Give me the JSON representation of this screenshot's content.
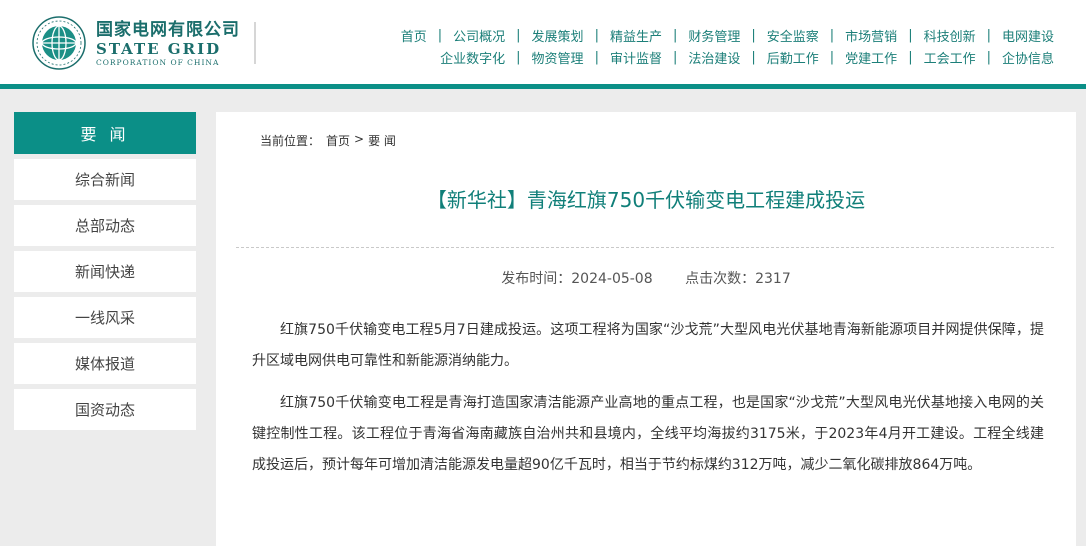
{
  "header": {
    "logo_cn": "国家电网有限公司",
    "logo_en": "STATE GRID",
    "logo_en_sub": "CORPORATION OF CHINA",
    "nav_row1": [
      "首页",
      "公司概况",
      "发展策划",
      "精益生产",
      "财务管理",
      "安全监察",
      "市场营销",
      "科技创新",
      "电网建设"
    ],
    "nav_row2": [
      "企业数字化",
      "物资管理",
      "审计监督",
      "法治建设",
      "后勤工作",
      "党建工作",
      "工会工作",
      "企协信息"
    ]
  },
  "sidebar": {
    "heading": "要 闻",
    "items": [
      "综合新闻",
      "总部动态",
      "新闻快递",
      "一线风采",
      "媒体报道",
      "国资动态"
    ]
  },
  "breadcrumb": {
    "prefix": "当前位置：",
    "home": "首页",
    "separator": ">",
    "current": "要 闻"
  },
  "article": {
    "title": "【新华社】青海红旗750千伏输变电工程建成投运",
    "publish_time": "发布时间：2024-05-08",
    "clicks": "点击次数：2317",
    "paragraphs": [
      "红旗750千伏输变电工程5月7日建成投运。这项工程将为国家“沙戈荒”大型风电光伏基地青海新能源项目并网提供保障，提升区域电网供电可靠性和新能源消纳能力。",
      "红旗750千伏输变电工程是青海打造国家清洁能源产业高地的重点工程，也是国家“沙戈荒”大型风电光伏基地接入电网的关键控制性工程。该工程位于青海省海南藏族自治州共和县境内，全线平均海拔约3175米，于2023年4月开工建设。工程全线建成投运后，预计每年可增加清洁能源发电量超90亿千瓦时，相当于节约标煤约312万吨，减少二氧化碳排放864万吨。"
    ]
  },
  "colors": {
    "brand": "#0b8f87",
    "title": "#107f79",
    "nav": "#1c7f79"
  },
  "icons": {
    "logo": "state-grid-globe-icon"
  }
}
